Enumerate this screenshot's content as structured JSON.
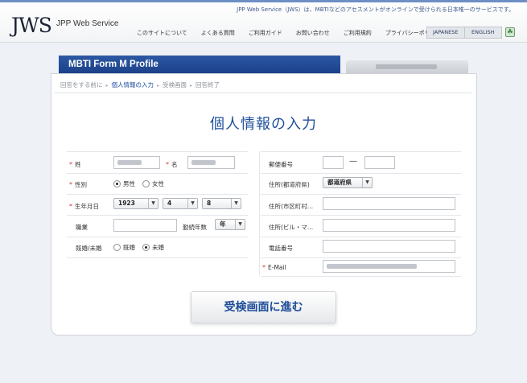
{
  "header": {
    "tagline": "JPP Web Service（JWS）は、MBTIなどのアセスメントがオンラインで受けられる日本唯一のサービスです。",
    "logo": "JWS",
    "logo_sub": "JPP Web Service",
    "nav": [
      "このサイトについて",
      "よくある質問",
      "ご利用ガイド",
      "お問い合わせ",
      "ご利用規約",
      "プライバシーポリシー"
    ],
    "lang": [
      "JAPANESE",
      "ENGLISH"
    ],
    "access_icon": "accessibility-icon"
  },
  "tabs": {
    "active": "MBTI Form M Profile"
  },
  "breadcrumb": {
    "items": [
      "回答をする前に",
      "個人情報の入力",
      "受検画面",
      "回答終了"
    ],
    "current_index": 1
  },
  "title": "個人情報の入力",
  "form": {
    "sei_label": "姓",
    "mei_label": "名",
    "gender_label": "性別",
    "gender_male": "男性",
    "gender_female": "女性",
    "gender_selected": "男性",
    "birth_label": "生年月日",
    "birth_year": "1923",
    "birth_month": "4",
    "birth_day": "8",
    "job_label": "職業",
    "years_label": "勤続年数",
    "years_unit": "年",
    "married_label": "既婚/未婚",
    "married_yes": "既婚",
    "married_no": "未婚",
    "married_selected": "未婚",
    "zip_label": "郵便番号",
    "zip_dash": "—",
    "pref_label": "住所(都道府県)",
    "pref_select": "都道府県",
    "city_label": "住所(市区町村...",
    "building_label": "住所(ビル・マ...",
    "phone_label": "電話番号",
    "email_label": "E-Mail"
  },
  "submit_label": "受検画面に進む",
  "colors": {
    "accent": "#1f4f9c",
    "required": "#d23c3c",
    "tab_bg": "#2350a0"
  }
}
